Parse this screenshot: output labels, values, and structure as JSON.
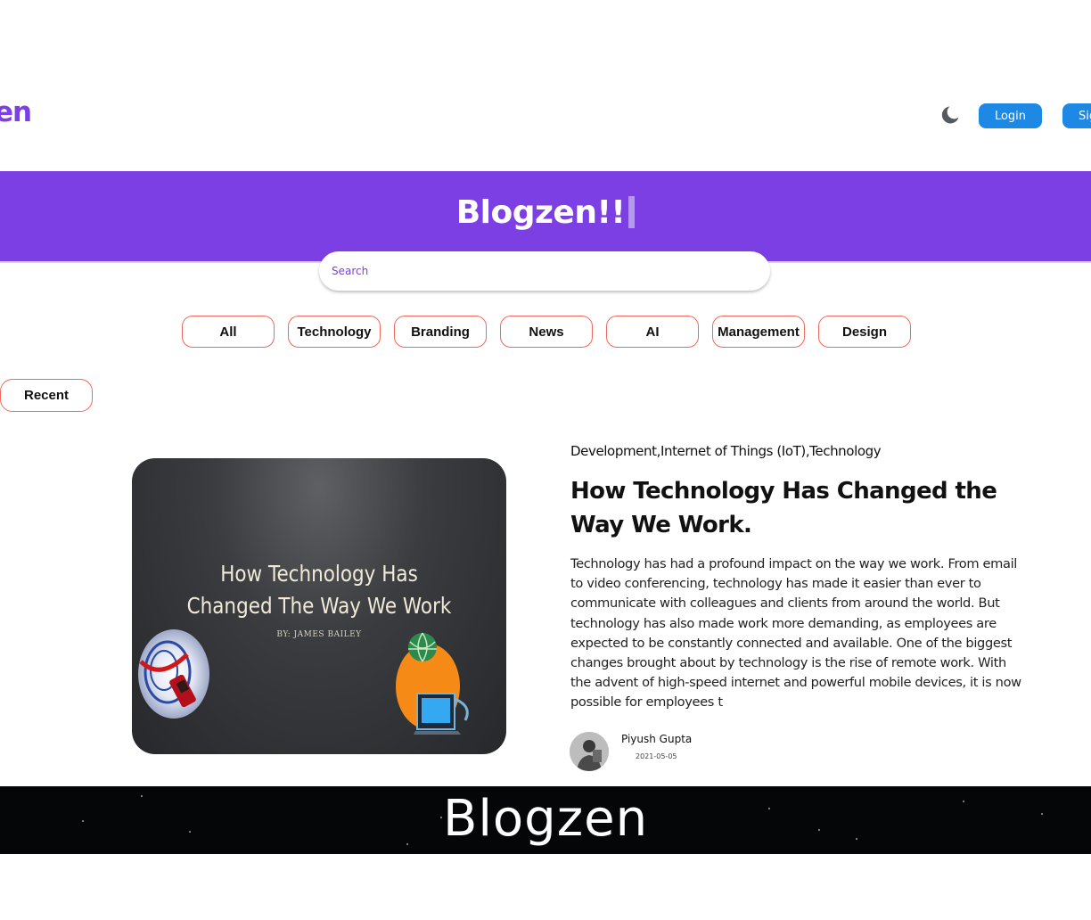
{
  "header": {
    "logo_text": "en",
    "login_label": "Login",
    "signup_label": "Sig"
  },
  "hero": {
    "title": "Blogzen!!",
    "search_placeholder": "Search"
  },
  "categories": [
    "All",
    "Technology",
    "Branding",
    "News",
    "AI",
    "Management",
    "Design"
  ],
  "section": {
    "recent_label": "Recent"
  },
  "post": {
    "image": {
      "title_line1": "How Technology Has",
      "title_line2": "Changed The Way We Work",
      "byline": "BY: JAMES BAILEY"
    },
    "categories": "Development,Internet of Things (IoT),Technology",
    "title": "How Technology Has Changed the Way We Work.",
    "excerpt": "Technology has had a profound impact on the way we work. From email to video conferencing, technology has made it easier than ever to communicate with colleagues and clients from around the world. But technology has also made work more demanding, as employees are expected to be constantly connected and available. One of the biggest changes brought about by technology is the rise of remote work. With the advent of high-speed internet and powerful mobile devices, it is now possible for employees t",
    "author": "Piyush Gupta",
    "date": "2021-05-05"
  },
  "footer": {
    "title": "Blogzen"
  },
  "colors": {
    "brand_purple": "#7b3fe4",
    "button_blue": "#1e88e5",
    "category_border": "#f06a5a",
    "footer_bg": "#050608"
  },
  "icons": {
    "theme_toggle": "moon-icon"
  }
}
